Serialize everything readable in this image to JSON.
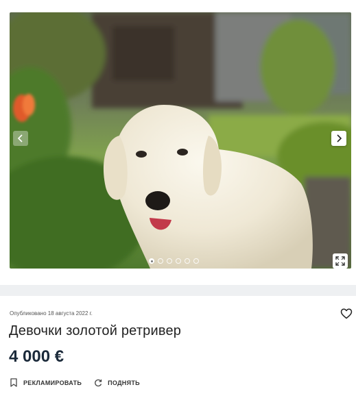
{
  "gallery": {
    "image_alt": "Золотистый ретривер",
    "slide_count": 6,
    "active_slide": 1,
    "icons": {
      "prev": "chevron-left-icon",
      "next": "chevron-right-icon",
      "expand": "expand-icon"
    }
  },
  "listing": {
    "published": "Опубликовано 18 августа 2022 г.",
    "title": "Девочки золотой ретривер",
    "price": "4 000 €"
  },
  "actions": {
    "promote_label": "РЕКЛАМИРОВАТЬ",
    "raise_label": "ПОДНЯТЬ"
  },
  "colors": {
    "separator": "#eef0f2",
    "price": "#1b2a3a"
  }
}
